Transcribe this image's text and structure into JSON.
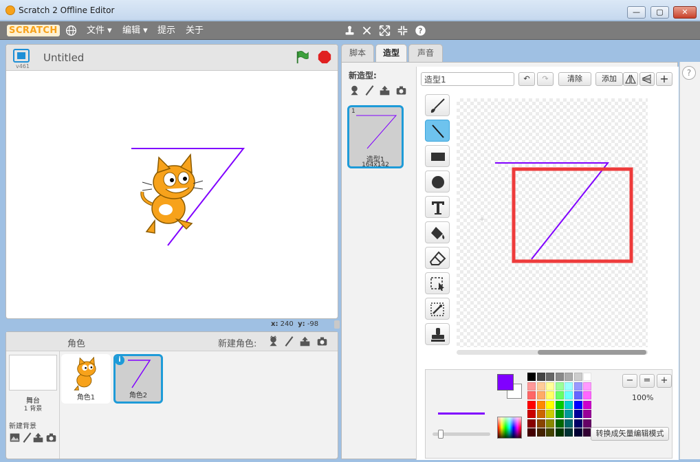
{
  "window": {
    "title": "Scratch 2 Offline Editor",
    "min": "—",
    "max": "▢",
    "close": "✕"
  },
  "menubar": {
    "logo": "SCRATCH",
    "items": [
      "文件 ▾",
      "编辑 ▾",
      "提示",
      "关于"
    ],
    "tools": [
      "duplicate-icon",
      "cut-icon",
      "grow-icon",
      "shrink-icon",
      "help-icon"
    ]
  },
  "stage": {
    "version": "v461",
    "project_title": "Untitled",
    "coords": {
      "x_label": "x:",
      "x": "240",
      "y_label": "y:",
      "y": "-98"
    }
  },
  "sprites": {
    "header": "角色",
    "new_sprite_label": "新建角色:",
    "stage_label": "舞台",
    "stage_bg_count": "1 背景",
    "new_bg_label": "新建背景",
    "items": [
      {
        "name": "角色1"
      },
      {
        "name": "角色2",
        "selected": true
      }
    ]
  },
  "editor": {
    "tabs": [
      "脚本",
      "造型",
      "声音"
    ],
    "active_tab": "造型",
    "new_costume_label": "新造型:",
    "costume": {
      "index": "1",
      "name": "造型1",
      "size": "164x142"
    },
    "paint": {
      "costume_name_value": "造型1",
      "undo": "↶",
      "redo": "↷",
      "clear": "清除",
      "add": "添加",
      "center": "+",
      "zoom_level": "100%",
      "zoom_out": "−",
      "zoom_reset": "=",
      "zoom_in": "+",
      "bitmap_button": "转换成矢量编辑模式",
      "primary_color": "#8000ff",
      "secondary_color": "#ffffff",
      "tools": [
        "brush-icon",
        "line-icon",
        "rectangle-icon",
        "ellipse-icon",
        "text-icon",
        "fill-icon",
        "eraser-icon",
        "select-icon",
        "reshape-icon",
        "stamp-icon"
      ],
      "active_tool": "line-icon"
    }
  },
  "help": "?",
  "colors": {
    "accent": "#1e9bd8",
    "line": "#8000ff",
    "highlight": "#ee3b3b"
  }
}
